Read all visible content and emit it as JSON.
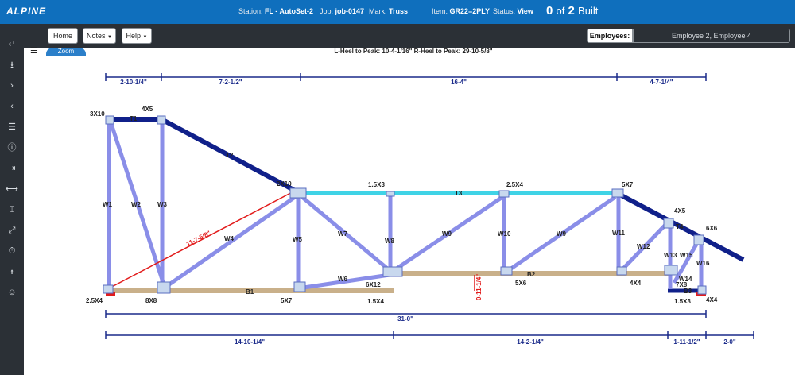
{
  "header": {
    "logo": "ALPINE",
    "station_label": "Station:",
    "station_value": "FL - AutoSet-2",
    "job_label": "Job:",
    "job_value": "job-0147",
    "mark_label": "Mark:",
    "mark_value": "Truss",
    "item_label": "Item:",
    "item_value": "GR22=2PLY",
    "status_label": "Status:",
    "status_value": "View",
    "built_count": "0",
    "built_of": "of",
    "built_total": "2",
    "built_word": "Built"
  },
  "toolbar": {
    "home": "Home",
    "notes": "Notes",
    "help": "Help",
    "employees_label": "Employees:",
    "employees_value": "Employee 2, Employee 4"
  },
  "zoom_label": "Zoom",
  "heel_info": "L-Heel to Peak: 10-4-1/16\"  R-Heel to Peak: 29-10-5/8\"",
  "sidebar_icons": [
    "back-arrow-icon",
    "download-icon",
    "chevron-right-icon",
    "chevron-left-icon",
    "list-icon",
    "info-icon",
    "login-icon",
    "width-icon",
    "height-icon",
    "expand-icon",
    "no-timer-icon",
    "upload-icon",
    "user-icon"
  ],
  "dimensions": {
    "top": [
      "2-10-1/4\"",
      "7-2-1/2\"",
      "16-4\"",
      "4-7-1/4\""
    ],
    "overall": "31-0\"",
    "bottom": [
      "14-10-1/4\"",
      "14-2-1/4\"",
      "1-11-1/2\"",
      "2-0\""
    ]
  },
  "plates": [
    "3X10",
    "4X5",
    "2X10",
    "1.5X3",
    "2.5X4",
    "5X7",
    "4X5",
    "6X6",
    "2.5X4",
    "8X8",
    "5X7",
    "6X12",
    "1.5X4",
    "5X6",
    "4X4",
    "7X8",
    "1.5X3",
    "4X4"
  ],
  "members": [
    "T1",
    "T2",
    "T3",
    "T4",
    "W1",
    "W2",
    "W3",
    "W4",
    "W5",
    "W6",
    "W7",
    "W8",
    "W9",
    "W10",
    "W9",
    "W11",
    "W12",
    "W13",
    "W15",
    "W16",
    "W14",
    "B1",
    "B2",
    "B3"
  ],
  "red_dims": {
    "diagonal": "11-7-5/8\"",
    "vertical": "0-11-1/4\""
  }
}
